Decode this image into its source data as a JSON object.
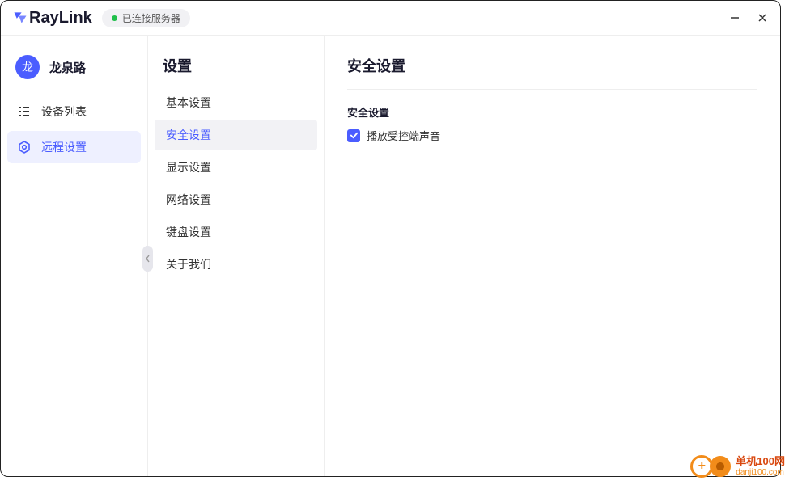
{
  "app": {
    "name": "RayLink",
    "status": "已连接服务器"
  },
  "profile": {
    "avatar_char": "龙",
    "name": "龙泉路"
  },
  "sidebar": {
    "items": [
      {
        "label": "设备列表",
        "active": false
      },
      {
        "label": "远程设置",
        "active": true
      }
    ]
  },
  "settings": {
    "title": "设置",
    "items": [
      {
        "label": "基本设置"
      },
      {
        "label": "安全设置"
      },
      {
        "label": "显示设置"
      },
      {
        "label": "网络设置"
      },
      {
        "label": "键盘设置"
      },
      {
        "label": "关于我们"
      }
    ],
    "active_index": 1
  },
  "content": {
    "title": "安全设置",
    "section_header": "安全设置",
    "checkbox_label": "播放受控端声音",
    "checkbox_checked": true
  },
  "watermark": {
    "text_top": "单机100网",
    "text_bottom": "danji100.com"
  }
}
